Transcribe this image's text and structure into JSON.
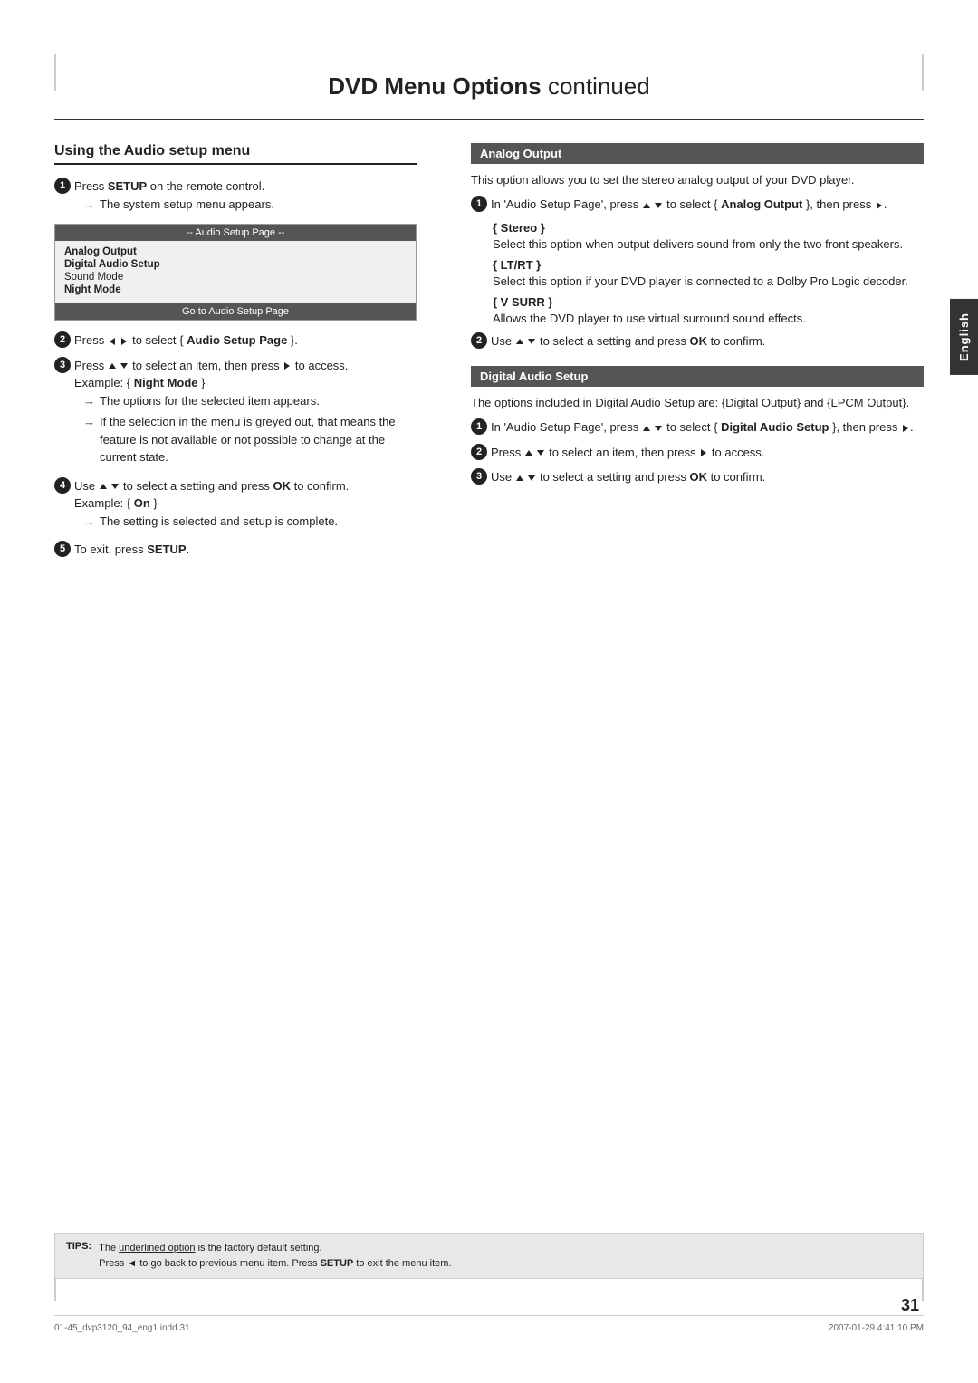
{
  "page": {
    "title": "DVD Menu Options",
    "continued": "continued",
    "page_number": "31",
    "english_tab": "English"
  },
  "left_section": {
    "heading": "Using the Audio setup menu",
    "step1": {
      "text": "Press ",
      "bold": "SETUP",
      "text2": " on the remote control.",
      "bullet": "The system setup menu appears."
    },
    "menu_box": {
      "header": "-- Audio Setup Page --",
      "items": [
        {
          "text": "Analog Output",
          "bold": true
        },
        {
          "text": "Digital Audio Setup",
          "bold": true
        },
        {
          "text": "Sound Mode",
          "bold": false
        },
        {
          "text": "Night Mode",
          "bold": true
        }
      ],
      "footer": "Go to Audio Setup Page"
    },
    "step2": {
      "text": "Press ",
      "text2": " to select { ",
      "bold": "Audio Setup Page",
      "text3": " }."
    },
    "step3": {
      "text": "Press ",
      "text2": " to select an item, then press",
      "text3": " to access.",
      "example_label": "Example: { ",
      "example_bold": "Night Mode",
      "example_end": " }",
      "bullet1": "The options for the selected item appears.",
      "bullet2": "If the selection in the menu is greyed out, that means the feature is not available or not possible to change at the current state."
    },
    "step4": {
      "text": "Use ",
      "text2": " to select a setting and press ",
      "bold": "OK",
      "text3": " to confirm.",
      "example_label": "Example: { ",
      "example_bold": "On",
      "example_end": " }",
      "bullet": "The setting is selected and setup is complete."
    },
    "step5": {
      "text": "To exit, press ",
      "bold": "SETUP",
      "text2": "."
    }
  },
  "right_section": {
    "analog_output": {
      "header": "Analog Output",
      "intro": "This option allows you to set the stereo analog output of your DVD player.",
      "step1": "In 'Audio Setup Page', press ▲ ▼ to select { Analog Output }, then press ▶.",
      "step1_select": "Analog Output",
      "stereo_heading": "{ Stereo }",
      "stereo_text": "Select this option when output delivers sound from only the two front speakers.",
      "ltrt_heading": "{ LT/RT }",
      "ltrt_text": "Select this option if your DVD player is connected to a Dolby Pro Logic decoder.",
      "vsurr_heading": "{ V SURR }",
      "vsurr_text": "Allows the DVD player to use virtual surround sound effects.",
      "step2": "Use ▲ ▼ to select a setting and press OK to confirm."
    },
    "digital_audio": {
      "header": "Digital Audio Setup",
      "intro": "The options included in Digital Audio Setup are: {Digital Output} and {LPCM Output}.",
      "step1": "In 'Audio Setup Page', press ▲ ▼ to select { Digital Audio Setup }, then press ▶.",
      "step1_select": "Digital Audio Setup",
      "step2": "Press ▲ ▼ to select an item, then press ▶ to access.",
      "step3": "Use ▲ ▼ to select a setting and press OK to confirm."
    }
  },
  "tips": {
    "label": "TIPS:",
    "line1": "The underlined option is the factory default setting.",
    "line2": "Press ◄ to go back to previous menu item. Press SETUP to exit the menu item."
  },
  "footer": {
    "left": "01-45_dvp3120_94_eng1.indd  31",
    "right": "2007-01-29   4:41:10 PM"
  }
}
